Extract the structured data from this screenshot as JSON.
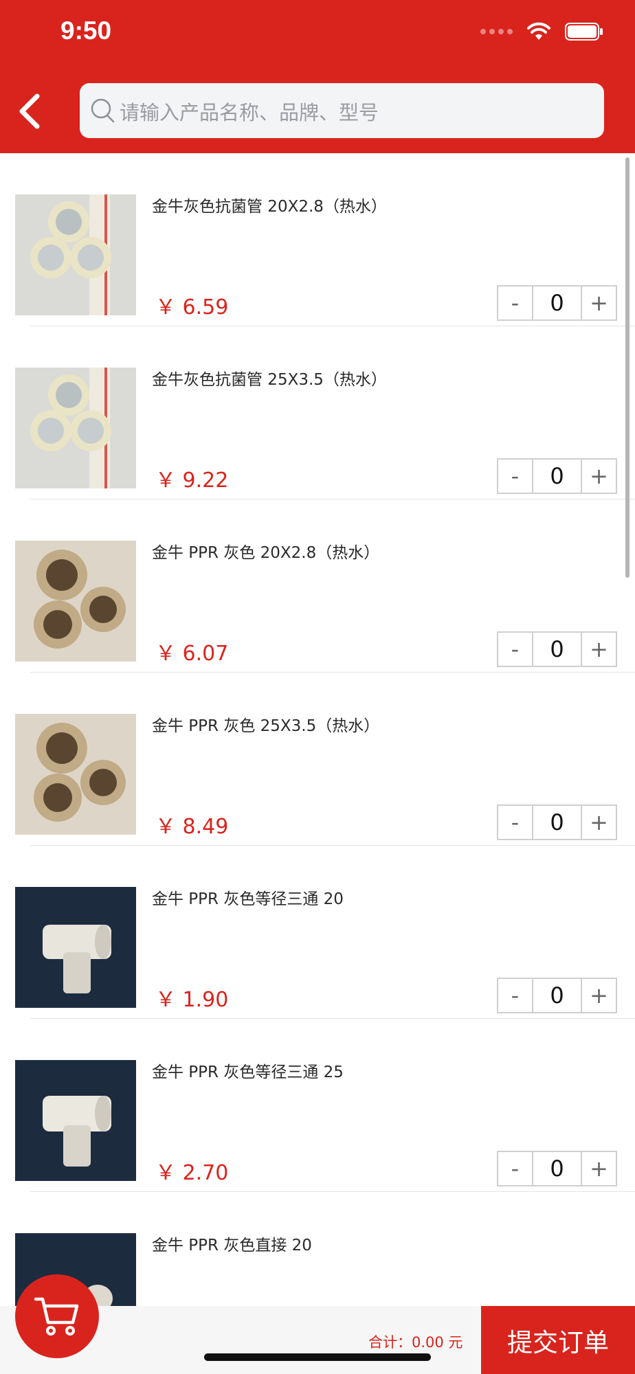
{
  "status_bar": {
    "time": "9:50"
  },
  "search": {
    "placeholder": "请输入产品名称、品牌、型号"
  },
  "products": [
    {
      "name": "金牛灰色抗菌管 20X2.8（热水）",
      "price": "￥ 6.59",
      "qty": "0",
      "image": "white-pipes"
    },
    {
      "name": "金牛灰色抗菌管 25X3.5（热水）",
      "price": "￥ 9.22",
      "qty": "0",
      "image": "white-pipes"
    },
    {
      "name": "金牛 PPR 灰色 20X2.8（热水）",
      "price": "￥ 6.07",
      "qty": "0",
      "image": "beige-pipes"
    },
    {
      "name": "金牛 PPR 灰色 25X3.5（热水）",
      "price": "￥ 8.49",
      "qty": "0",
      "image": "beige-pipes"
    },
    {
      "name": "金牛 PPR 灰色等径三通 20",
      "price": "￥ 1.90",
      "qty": "0",
      "image": "tee-fitting"
    },
    {
      "name": "金牛 PPR 灰色等径三通 25",
      "price": "￥ 2.70",
      "qty": "0",
      "image": "tee-fitting"
    },
    {
      "name": "金牛 PPR 灰色直接 20",
      "price": "",
      "qty": "",
      "image": "coupling"
    }
  ],
  "stepper": {
    "minus": "-",
    "plus": "+"
  },
  "footer": {
    "total": "合计：0.00 元",
    "submit_label": "提交订单"
  },
  "colors": {
    "brand_red": "#d9241d"
  }
}
